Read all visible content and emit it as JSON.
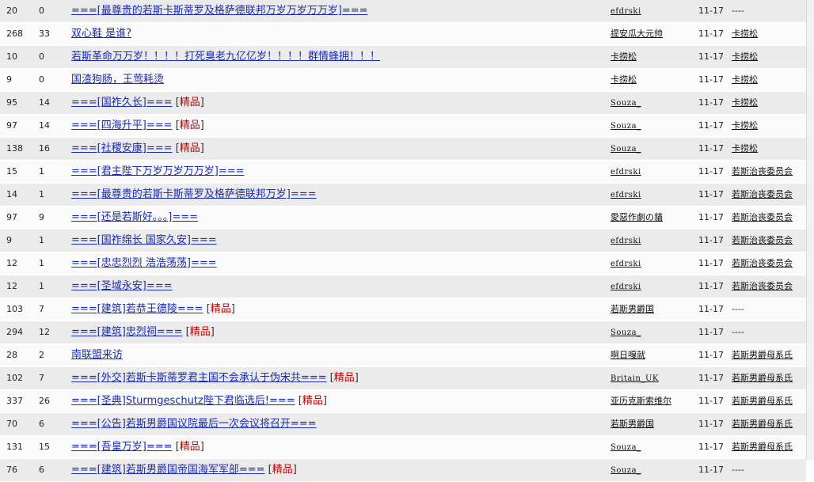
{
  "tag_label": "精品",
  "rows": [
    {
      "views": "20",
      "replies": "0",
      "title": "===[最尊贵的若斯卡斯蒂罗及格萨德联邦万岁万岁万万岁]===",
      "featured": false,
      "author": "efdrski",
      "date": "11-17",
      "last": "----"
    },
    {
      "views": "268",
      "replies": "33",
      "title": "双心鞋 是谁?",
      "featured": false,
      "author": "提安瓜大元帅",
      "date": "11-17",
      "last": "卡捞松"
    },
    {
      "views": "10",
      "replies": "0",
      "title": "若斯革命万万岁！！！！打死臭老九亿亿岁！！！！群情蜂拥！！！",
      "featured": false,
      "author": "卡捞松",
      "date": "11-17",
      "last": "卡捞松"
    },
    {
      "views": "9",
      "replies": "0",
      "title": "国渣狗肠，王莺耗烫",
      "featured": false,
      "author": "卡捞松",
      "date": "11-17",
      "last": "卡捞松"
    },
    {
      "views": "95",
      "replies": "14",
      "title": "===[国祚久长]===",
      "featured": true,
      "author": "Souza_",
      "date": "11-17",
      "last": "卡捞松"
    },
    {
      "views": "97",
      "replies": "14",
      "title": "===[四海升平]===",
      "featured": true,
      "author": "Souza_",
      "date": "11-17",
      "last": "卡捞松"
    },
    {
      "views": "138",
      "replies": "16",
      "title": "===[社稷安康]===",
      "featured": true,
      "author": "Souza_",
      "date": "11-17",
      "last": "卡捞松"
    },
    {
      "views": "15",
      "replies": "1",
      "title": "===[君主陛下万岁万岁万万岁]===",
      "featured": false,
      "author": "efdrski",
      "date": "11-17",
      "last": "若斯治丧委员会"
    },
    {
      "views": "14",
      "replies": "1",
      "title": "===[最尊贵的若斯卡斯蒂罗及格萨德联邦万岁]===",
      "featured": false,
      "author": "efdrski",
      "date": "11-17",
      "last": "若斯治丧委员会"
    },
    {
      "views": "97",
      "replies": "9",
      "title": "===[还是若斯好。。。]===",
      "featured": false,
      "author": "愛惡作劇の貓",
      "date": "11-17",
      "last": "若斯治丧委员会"
    },
    {
      "views": "9",
      "replies": "1",
      "title": "===[国祚绵长 国家久安]===",
      "featured": false,
      "author": "efdrski",
      "date": "11-17",
      "last": "若斯治丧委员会"
    },
    {
      "views": "12",
      "replies": "1",
      "title": "===[忠忠烈烈 浩浩荡荡]===",
      "featured": false,
      "author": "efdrski",
      "date": "11-17",
      "last": "若斯治丧委员会"
    },
    {
      "views": "12",
      "replies": "1",
      "title": "===[圣域永安]===",
      "featured": false,
      "author": "efdrski",
      "date": "11-17",
      "last": "若斯治丧委员会"
    },
    {
      "views": "103",
      "replies": "7",
      "title": "===[建筑]若恭王德陵===",
      "featured": true,
      "author": "若斯男爵国",
      "date": "11-17",
      "last": "----"
    },
    {
      "views": "294",
      "replies": "12",
      "title": "===[建筑]忠烈祠===",
      "featured": true,
      "author": "Souza_",
      "date": "11-17",
      "last": "----"
    },
    {
      "views": "28",
      "replies": "2",
      "title": "南联盟来访",
      "featured": false,
      "author": "啊日嘎就",
      "date": "11-17",
      "last": "若斯男爵母系氏"
    },
    {
      "views": "102",
      "replies": "7",
      "title": "===[外交]若斯卡斯蒂罗君主国不会承认于伪宋共===",
      "featured": true,
      "author": "Britain_UK",
      "date": "11-17",
      "last": "若斯男爵母系氏"
    },
    {
      "views": "337",
      "replies": "26",
      "title": "===[圣典]Sturmgeschutz陛下君临选后!===",
      "featured": true,
      "author": "亚历克斯索维尔",
      "date": "11-17",
      "last": "若斯男爵母系氏"
    },
    {
      "views": "70",
      "replies": "6",
      "title": "===[公告]若斯男爵国议院最后一次会议将召开===",
      "featured": false,
      "author": "若斯男爵国",
      "date": "11-17",
      "last": "若斯男爵母系氏"
    },
    {
      "views": "131",
      "replies": "15",
      "title": "===[吾皇万岁]===",
      "featured": true,
      "author": "Souza_",
      "date": "11-17",
      "last": "若斯男爵母系氏"
    },
    {
      "views": "76",
      "replies": "6",
      "title": "===[建筑]若斯男爵国帝国海军军部===",
      "featured": true,
      "author": "Souza_",
      "date": "11-17",
      "last": "----"
    }
  ]
}
